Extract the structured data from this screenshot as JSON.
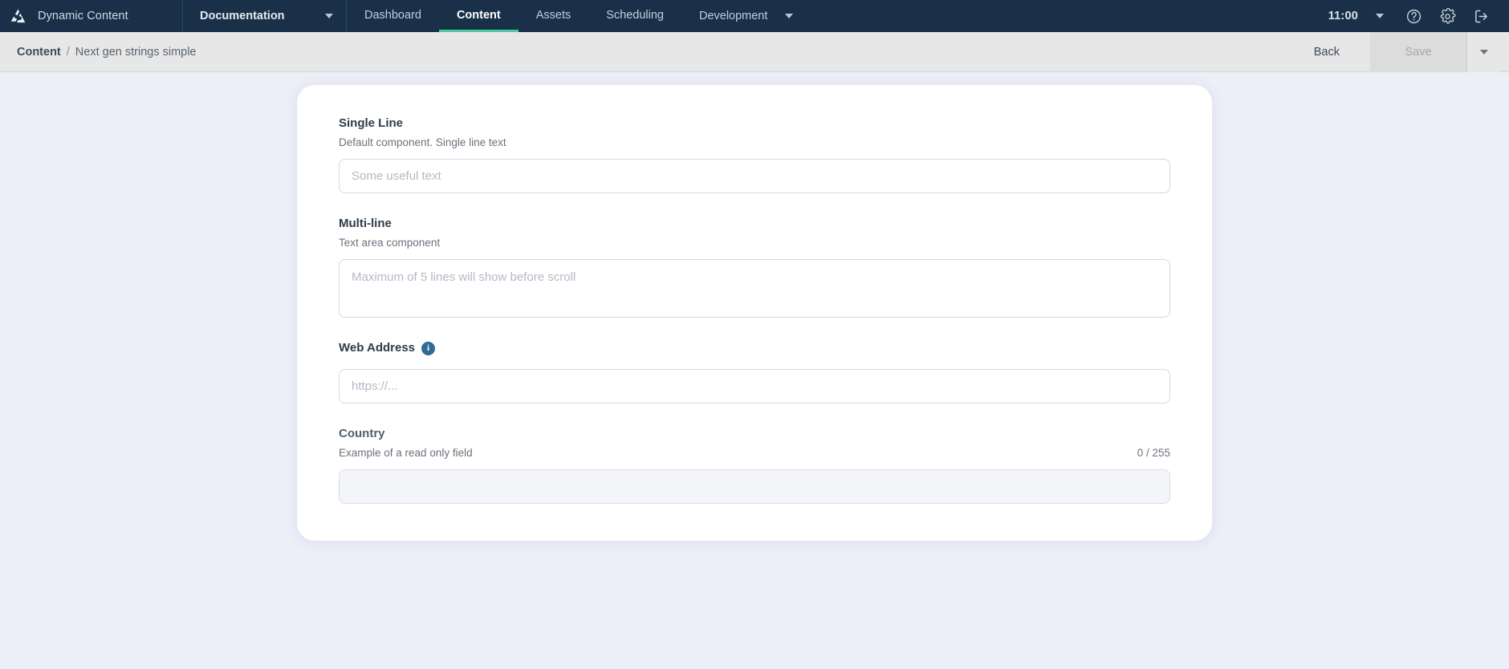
{
  "topnav": {
    "brand": "Dynamic Content",
    "logo_icon": "amplience-triangle-logo",
    "repo": {
      "label": "Documentation",
      "caret_icon": "chevron-down-icon"
    },
    "tabs": [
      {
        "label": "Dashboard",
        "active": false
      },
      {
        "label": "Content",
        "active": true
      },
      {
        "label": "Assets",
        "active": false
      },
      {
        "label": "Scheduling",
        "active": false
      }
    ],
    "env": {
      "label": "Development",
      "caret_icon": "chevron-down-icon"
    },
    "clock": {
      "time": "11:00",
      "caret_icon": "chevron-down-icon"
    },
    "actions": [
      {
        "name": "help-icon",
        "title": "Help"
      },
      {
        "name": "gear-icon",
        "title": "Settings"
      },
      {
        "name": "logout-icon",
        "title": "Log out"
      }
    ]
  },
  "subheader": {
    "breadcrumb": {
      "root": "Content",
      "separator": "/",
      "leaf": "Next gen strings simple"
    },
    "back_label": "Back",
    "save_label": "Save",
    "save_caret_icon": "chevron-down-icon"
  },
  "form": {
    "fields": [
      {
        "id": "single-line",
        "label": "Single Line",
        "description": "Default component. Single line text",
        "placeholder": "Some useful text",
        "value": "",
        "type": "text",
        "info": false,
        "readonly": false,
        "counter": ""
      },
      {
        "id": "multi-line",
        "label": "Multi-line",
        "description": "Text area component",
        "placeholder": "Maximum of 5 lines will show before scroll",
        "value": "",
        "type": "textarea",
        "info": false,
        "readonly": false,
        "counter": ""
      },
      {
        "id": "web-address",
        "label": "Web Address",
        "description": "",
        "placeholder": "https://...",
        "value": "",
        "type": "text",
        "info": true,
        "info_glyph": "i",
        "readonly": false,
        "counter": ""
      },
      {
        "id": "country",
        "label": "Country",
        "description": "Example of a read only field",
        "placeholder": "",
        "value": "",
        "type": "text",
        "info": false,
        "readonly": true,
        "counter": "0 / 255"
      }
    ]
  },
  "colors": {
    "nav_bg": "#1a3049",
    "accent_active_tab": "#4ecba0",
    "page_bg": "#eceef8",
    "card_bg": "#ffffff",
    "subheader_bg": "#e7e7e7",
    "info_icon_bg": "#2e6b96"
  }
}
